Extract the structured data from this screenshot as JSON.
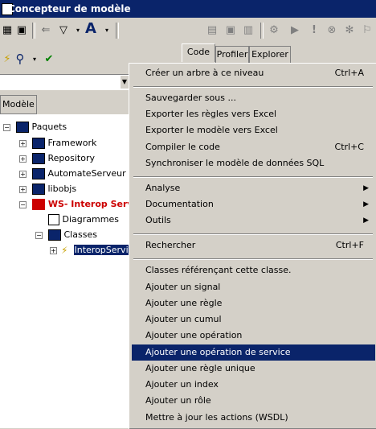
{
  "window": {
    "title": "Concepteur de modèle"
  },
  "tabs": [
    {
      "label": "Code"
    },
    {
      "label": "Profiler"
    },
    {
      "label": "Explorer"
    }
  ],
  "panel": {
    "header": "Modèle"
  },
  "tree": {
    "root": "Paquets",
    "items": [
      {
        "label": "Framework"
      },
      {
        "label": "Repository"
      },
      {
        "label": "AutomateServeur"
      },
      {
        "label": "libobjs"
      },
      {
        "label": "WS- Interop Servi"
      },
      {
        "label": "Diagrammes"
      },
      {
        "label": "Classes"
      },
      {
        "label": "InteropServic"
      }
    ]
  },
  "menu": {
    "items": [
      {
        "label": "Créer un arbre à ce niveau",
        "shortcut": "Ctrl+A"
      },
      {
        "label": "Sauvegarder sous ..."
      },
      {
        "label": "Exporter les règles vers Excel"
      },
      {
        "label": "Exporter le modèle vers Excel"
      },
      {
        "label": "Compiler le code",
        "shortcut": "Ctrl+C"
      },
      {
        "label": "Synchroniser le modèle de données SQL"
      },
      {
        "label": "Analyse"
      },
      {
        "label": "Documentation"
      },
      {
        "label": "Outils"
      },
      {
        "label": "Rechercher",
        "shortcut": "Ctrl+F"
      },
      {
        "label": "Classes référençant cette classe."
      },
      {
        "label": "Ajouter un signal"
      },
      {
        "label": "Ajouter une règle"
      },
      {
        "label": "Ajouter un cumul"
      },
      {
        "label": "Ajouter une opération"
      },
      {
        "label": "Ajouter une opération de service"
      },
      {
        "label": "Ajouter une règle unique"
      },
      {
        "label": "Ajouter un index"
      },
      {
        "label": "Ajouter un rôle"
      },
      {
        "label": "Mettre à jour les actions (WSDL)"
      }
    ]
  },
  "colors": {
    "titlebar": "#0a246a",
    "highlight": "#0a246a",
    "error_red": "#cc0000"
  }
}
